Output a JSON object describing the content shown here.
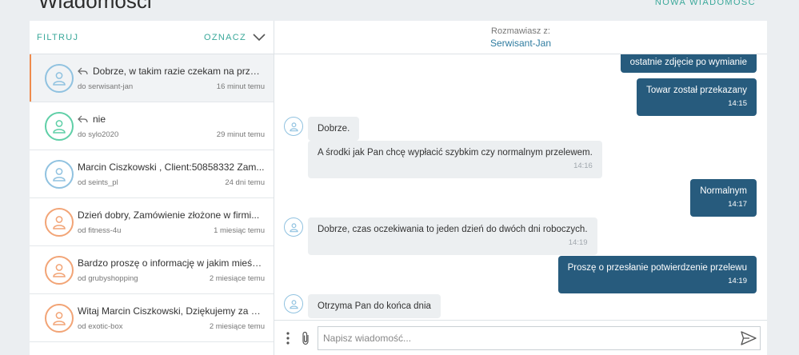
{
  "header": {
    "title": "Wiadomości",
    "new_message": "NOWA WIADOMOŚĆ"
  },
  "filter": {
    "filter_label": "FILTRUJ",
    "mark_label": "OZNACZ"
  },
  "conversations": [
    {
      "title": "Dobrze, w takim razie czekam na przelew.",
      "replied": true,
      "peer": "do serwisant-jan",
      "time": "16 minut temu",
      "avatar": "blue"
    },
    {
      "title": "nie",
      "replied": true,
      "peer": "do sylo2020",
      "time": "29 minut temu",
      "avatar": "green"
    },
    {
      "title": "Marcin Ciszkowski , Client:50858332 Zam...",
      "replied": false,
      "peer": "od seints_pl",
      "time": "24 dni temu",
      "avatar": "blue"
    },
    {
      "title": "Dzień dobry, Zamówienie złożone w firmi...",
      "replied": false,
      "peer": "od fitness-4u",
      "time": "1 miesiąc temu",
      "avatar": "orange"
    },
    {
      "title": "Bardzo proszę o informację w jakim mieśc...",
      "replied": false,
      "peer": "od grubyshopping",
      "time": "2 miesiące temu",
      "avatar": "orange"
    },
    {
      "title": "Witaj Marcin Ciszkowski, Dziękujemy za zł...",
      "replied": false,
      "peer": "od exotic-box",
      "time": "2 miesiące temu",
      "avatar": "orange"
    }
  ],
  "chat": {
    "with_label": "Rozmawiasz z:",
    "partner": "Serwisant-Jan",
    "messages": [
      {
        "dir": "out",
        "text": "ostatnie zdjęcie po wymianie",
        "time": ""
      },
      {
        "dir": "out",
        "text": "Towar został przekazany",
        "time": "14:15"
      },
      {
        "dir": "in",
        "text": "Dobrze.",
        "time": ""
      },
      {
        "dir": "in",
        "text": "A środki jak Pan chcę wypłacić szybkim czy normalnym przelewem.",
        "time": "14:16"
      },
      {
        "dir": "out",
        "text": "Normalnym",
        "time": "14:17"
      },
      {
        "dir": "in",
        "text": "Dobrze, czas oczekiwania to jeden dzień do dwóch dni roboczych.",
        "time": "14:19"
      },
      {
        "dir": "out",
        "text": "Proszę o przesłanie potwierdzenie przelewu",
        "time": "14:19"
      },
      {
        "dir": "in",
        "text": "Otrzyma Pan do końca dnia",
        "time": ""
      }
    ]
  },
  "composer": {
    "placeholder": "Napisz wiadomość..."
  },
  "icons": {
    "avatar": "user-icon",
    "reply": "reply-arrow-icon",
    "mark": "chevron-down-icon",
    "more": "more-vertical-icon",
    "attach": "paperclip-icon",
    "send": "send-icon"
  },
  "colors": {
    "accent": "#3aa89a",
    "outgoing": "#275b7d",
    "incoming": "#eceff1",
    "active_marker": "#ef8a4c",
    "partner_name": "#2f7ca0"
  }
}
